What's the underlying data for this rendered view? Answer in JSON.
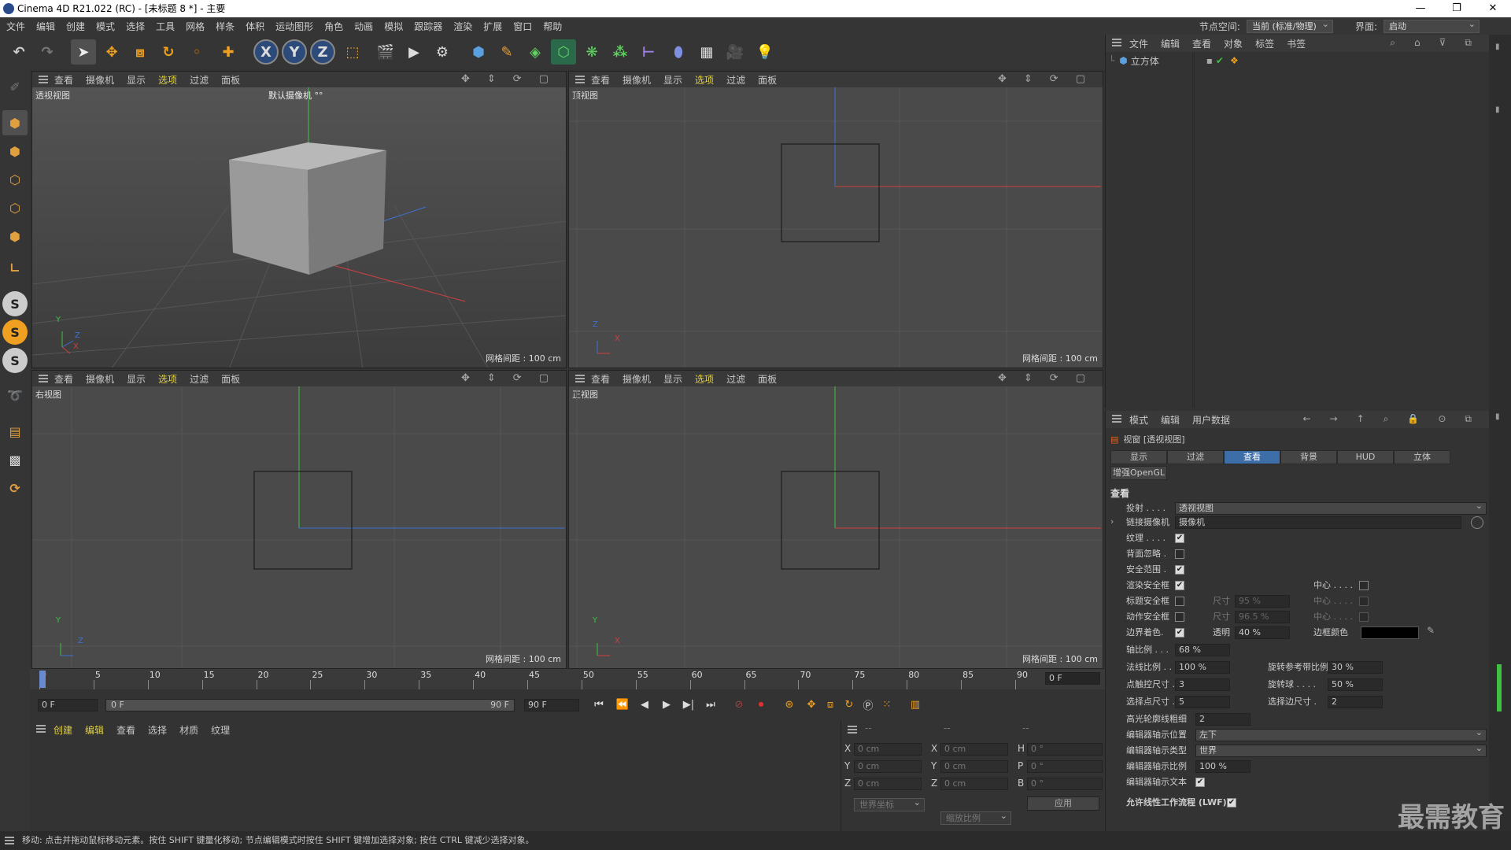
{
  "window": {
    "title": "Cinema 4D R21.022 (RC) - [未标题 8 *] - 主要",
    "controls": [
      "—",
      "❐",
      "✕"
    ]
  },
  "menu": {
    "items": [
      "文件",
      "编辑",
      "创建",
      "模式",
      "选择",
      "工具",
      "网格",
      "样条",
      "体积",
      "运动图形",
      "角色",
      "动画",
      "模拟",
      "跟踪器",
      "渲染",
      "扩展",
      "窗口",
      "帮助"
    ],
    "node_space_label": "节点空间:",
    "node_space_value": "当前 (标准/物理)",
    "layout_label": "界面:",
    "layout_value": "启动"
  },
  "toolbar": {
    "axis_x": "X",
    "axis_y": "Y",
    "axis_z": "Z"
  },
  "viewport_menu": [
    "查看",
    "摄像机",
    "显示",
    "选项",
    "过滤",
    "面板"
  ],
  "viewports": {
    "persp": {
      "name": "透视视图",
      "camera": "默认摄像机 °°",
      "grid": "网格间距 : 100 cm",
      "axes": {
        "y": "Y",
        "z": "Z",
        "x": "X"
      }
    },
    "top": {
      "name": "顶视图",
      "grid": "网格间距 : 100 cm",
      "axes": {
        "a": "Z",
        "b": "X"
      }
    },
    "right": {
      "name": "右视图",
      "grid": "网格间距 : 100 cm",
      "axes": {
        "a": "Y",
        "b": "Z"
      }
    },
    "front": {
      "name": "正视图",
      "grid": "网格间距 : 100 cm",
      "axes": {
        "a": "Y",
        "b": "X"
      }
    }
  },
  "object_manager": {
    "menu": [
      "文件",
      "编辑",
      "查看",
      "对象",
      "标签",
      "书签"
    ],
    "object_name": "立方体"
  },
  "attribute_manager": {
    "menu": [
      "模式",
      "编辑",
      "用户数据"
    ],
    "title": "视窗 [透视视图]",
    "tabs": [
      "显示",
      "过滤",
      "查看",
      "背景",
      "HUD",
      "立体"
    ],
    "active_tab": "查看",
    "subtab": "增强OpenGL",
    "section": "查看",
    "rows": {
      "projection_label": "投射 . . . .",
      "projection_value": "透视视图",
      "link_camera_label": "链接摄像机",
      "link_camera_value": "摄像机",
      "texture_label": "纹理 . . . .",
      "backface_label": "背面忽略 .",
      "safe_frame_label": "安全范围 .",
      "render_safe_label": "渲染安全框",
      "center_label": "中心 . . . .",
      "title_safe_label": "标题安全框",
      "size_label": "尺寸",
      "title_safe_size": "95 %",
      "action_safe_label": "动作安全框",
      "action_safe_size": "96.5 %",
      "border_color_label": "边界着色.",
      "opacity_label": "透明",
      "opacity_value": "40 %",
      "border_frame_color_label": "边框颜色",
      "axis_scale_label": "轴比例 . . .",
      "axis_scale_value": "68 %",
      "normal_scale_label": "法线比例 . .",
      "normal_scale_value": "100 %",
      "rot_ref_label": "旋转参考带比例",
      "rot_ref_value": "30 %",
      "point_size_label": "点触控尺寸 .",
      "point_size_value": "3",
      "rot_ball_label": "旋转球 . . . .",
      "rot_ball_value": "50 %",
      "sel_point_label": "选择点尺寸 .",
      "sel_point_value": "5",
      "sel_edge_label": "选择边尺寸 .",
      "sel_edge_value": "2",
      "highlight_label": "高光轮廓线粗细",
      "highlight_value": "2",
      "axis_pos_label": "编辑器轴示位置",
      "axis_pos_value": "左下",
      "axis_type_label": "编辑器轴示类型",
      "axis_type_value": "世界",
      "axis_ratio_label": "编辑器轴示比例",
      "axis_ratio_value": "100 %",
      "axis_text_label": "编辑器轴示文本",
      "lwf_label": "允许线性工作流程 (LWF)"
    }
  },
  "timeline": {
    "ticks": [
      "0",
      "5",
      "10",
      "15",
      "20",
      "25",
      "30",
      "35",
      "40",
      "45",
      "50",
      "55",
      "60",
      "65",
      "70",
      "75",
      "80",
      "85",
      "90"
    ],
    "current_frame": "0 F",
    "start": "0 F",
    "range_start": "0 F",
    "range_end": "90 F",
    "end": "90 F"
  },
  "material_manager": {
    "menu": [
      "创建",
      "编辑",
      "查看",
      "选择",
      "材质",
      "纹理"
    ]
  },
  "coordinates": {
    "header": [
      "--",
      "--",
      "--"
    ],
    "pos": [
      {
        "axis": "X",
        "value": "0 cm"
      },
      {
        "axis": "Y",
        "value": "0 cm"
      },
      {
        "axis": "Z",
        "value": "0 cm"
      }
    ],
    "size": [
      {
        "axis": "X",
        "value": "0 cm"
      },
      {
        "axis": "Y",
        "value": "0 cm"
      },
      {
        "axis": "Z",
        "value": "0 cm"
      }
    ],
    "rot": [
      {
        "axis": "H",
        "value": "0 °"
      },
      {
        "axis": "P",
        "value": "0 °"
      },
      {
        "axis": "B",
        "value": "0 °"
      }
    ],
    "space": "世界坐标",
    "scale": "缩放比例",
    "apply": "应用"
  },
  "status": "移动: 点击并拖动鼠标移动元素。按住 SHIFT 键量化移动; 节点编辑模式时按住 SHIFT 键增加选择对象; 按住 CTRL 键减少选择对象。",
  "watermark": "最需教育",
  "colors": {
    "active_tab": "#3e6ea8",
    "highlight_menu": "#e0d040",
    "x_axis": "#d04040",
    "y_axis": "#40c040",
    "z_axis": "#4070d0"
  }
}
